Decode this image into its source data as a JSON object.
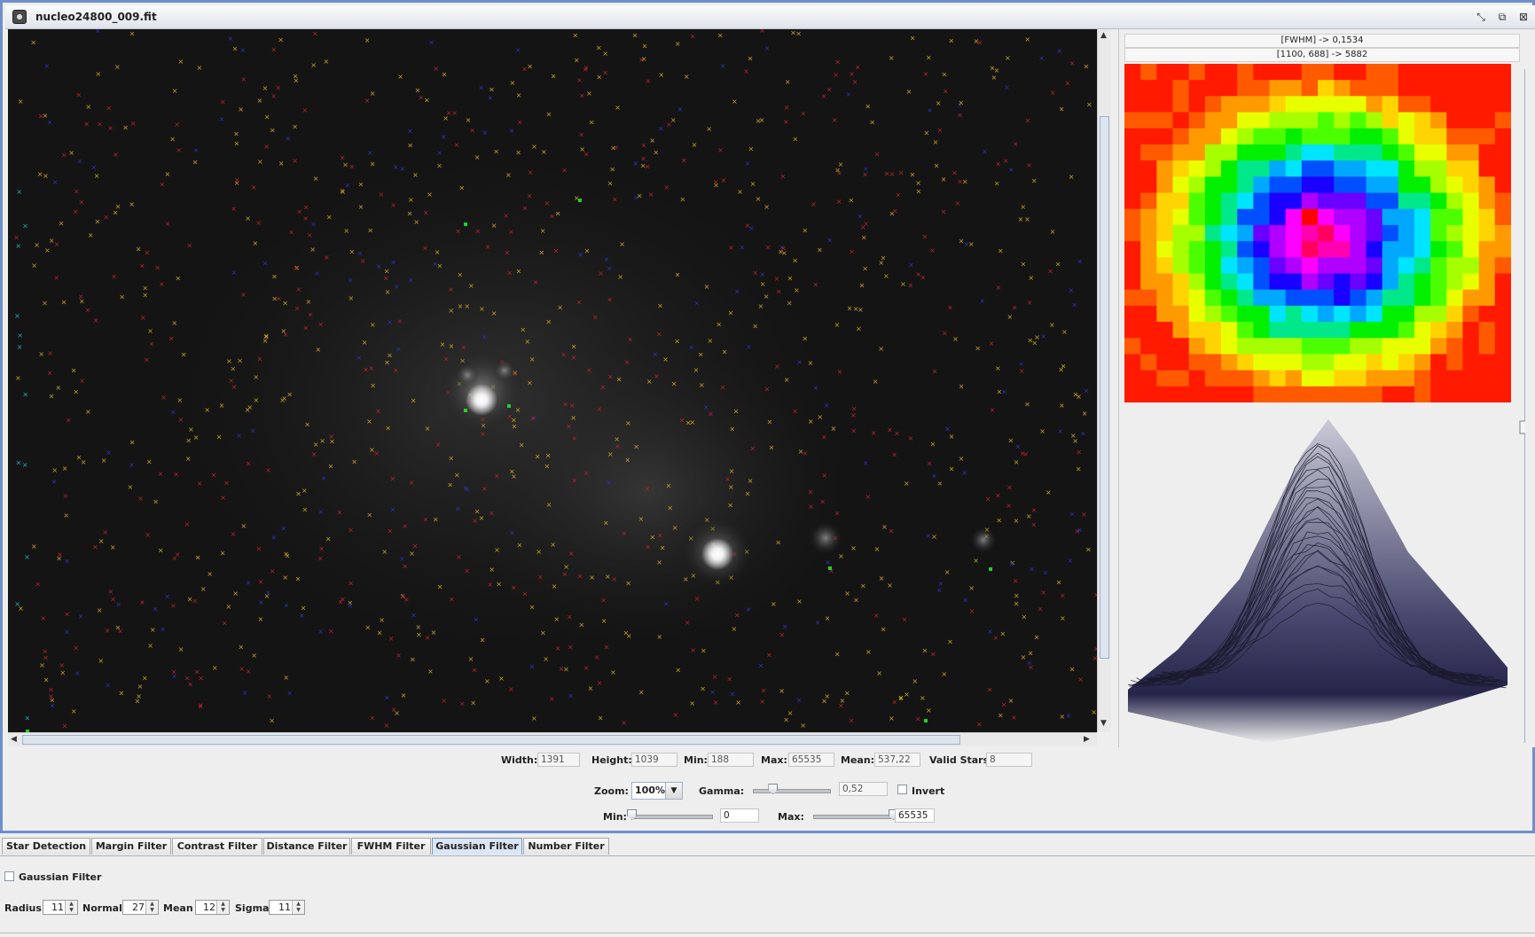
{
  "window": {
    "title": "nucleo24800_009.fit",
    "controls": [
      "minimize-restore",
      "maximize",
      "close"
    ]
  },
  "profile": {
    "fwhm_text": "[FWHM] -> 0,1534",
    "pixel_text": "[1100, 688] -> 5882"
  },
  "stats": {
    "width_label": "Width:",
    "width_value": "1391",
    "height_label": "Height:",
    "height_value": "1039",
    "min_label": "Min:",
    "min_value": "188",
    "max_label": "Max:",
    "max_value": "65535",
    "mean_label": "Mean:",
    "mean_value": "537,22",
    "valid_label": "Valid Stars",
    "valid_value": "8"
  },
  "display": {
    "zoom_label": "Zoom:",
    "zoom_value": "100%",
    "gamma_label": "Gamma:",
    "gamma_value": "0,52",
    "gamma_level": 0.26,
    "invert_label": "Invert",
    "invert_checked": false,
    "min_label": "Min:",
    "min_value": "0",
    "min_level": 0.0,
    "max_label": "Max:",
    "max_value": "65535",
    "max_level": 1.0
  },
  "tabs": [
    {
      "label": "Star Detection"
    },
    {
      "label": "Margin Filter"
    },
    {
      "label": "Contrast Filter"
    },
    {
      "label": "Distance Filter"
    },
    {
      "label": "FWHM Filter"
    },
    {
      "label": "Gaussian Filter",
      "active": true
    },
    {
      "label": "Number Filter"
    }
  ],
  "gaussian_panel": {
    "enable_label": "Gaussian Filter",
    "enabled": false,
    "radius_label": "Radius",
    "radius_value": "11",
    "normal_label": "Normal",
    "normal_value": "27",
    "mean_label": "Mean",
    "mean_value": "12",
    "sigma_label": "Sigma",
    "sigma_value": "11"
  },
  "colors": {
    "accent": "#6d8fcb",
    "marker_orange": "#c9a227",
    "marker_red": "#b3262b",
    "marker_blue": "#2b35b5",
    "marker_cyan": "#2aa9b5",
    "marker_green": "#1fd12a"
  },
  "icons": [
    "app-icon",
    "restore-icon",
    "maximize-icon",
    "close-icon",
    "dropdown-arrow-icon",
    "scroll-up-icon",
    "scroll-down-icon",
    "scroll-left-icon",
    "scroll-right-icon"
  ]
}
